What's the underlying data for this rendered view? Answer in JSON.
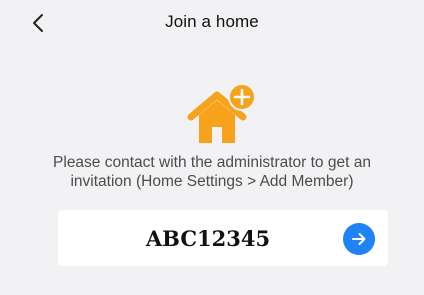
{
  "header": {
    "title": "Join a home",
    "back_icon": "chevron-left-icon"
  },
  "illustration": {
    "icon": "home-add-icon",
    "color": "#f7a21b"
  },
  "instructions": {
    "line1": "Please contact with the administrator to get an",
    "line2": "invitation (Home Settings > Add Member)"
  },
  "invite": {
    "code_value": "ABC12345",
    "submit_icon": "arrow-right-icon",
    "button_color": "#1f82f5"
  }
}
